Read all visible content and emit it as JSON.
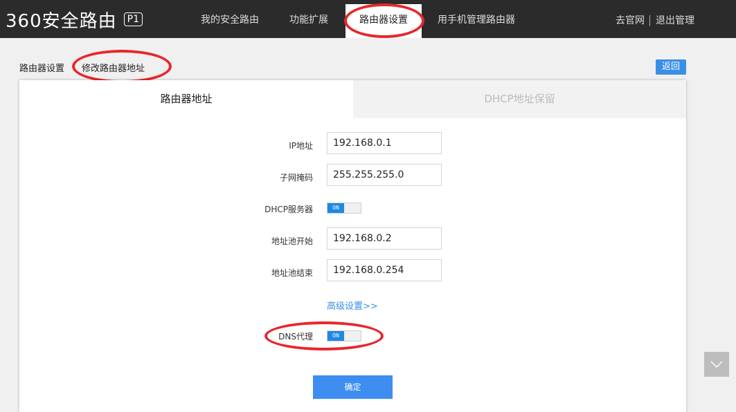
{
  "header": {
    "logo_text": "360安全路由",
    "logo_badge": "P1",
    "nav": [
      "我的安全路由",
      "功能扩展",
      "路由器设置",
      "用手机管理路由器"
    ],
    "active_nav": "路由器设置",
    "official_site": "去官网",
    "logout": "退出管理"
  },
  "breadcrumb": {
    "parent": "路由器设置",
    "current": "修改路由器地址"
  },
  "back_label": "返回",
  "tabs": {
    "active": "路由器地址",
    "inactive": "DHCP地址保留"
  },
  "form": {
    "ip_label": "IP地址",
    "ip_value": "192.168.0.1",
    "mask_label": "子网掩码",
    "mask_value": "255.255.255.0",
    "dhcp_label": "DHCP服务器",
    "dhcp_state": "ON",
    "pool_start_label": "地址池开始",
    "pool_start_value": "192.168.0.2",
    "pool_end_label": "地址池结束",
    "pool_end_value": "192.168.0.254",
    "advanced_link": "高级设置>>",
    "dns_label": "DNS代理",
    "dns_state": "ON",
    "submit_label": "确定"
  },
  "colors": {
    "accent": "#3a8ee6",
    "highlight_ring": "#e8262b",
    "topbar": "#2b2b2b"
  },
  "icons": {
    "scroll_down": "chevron-down-icon"
  }
}
